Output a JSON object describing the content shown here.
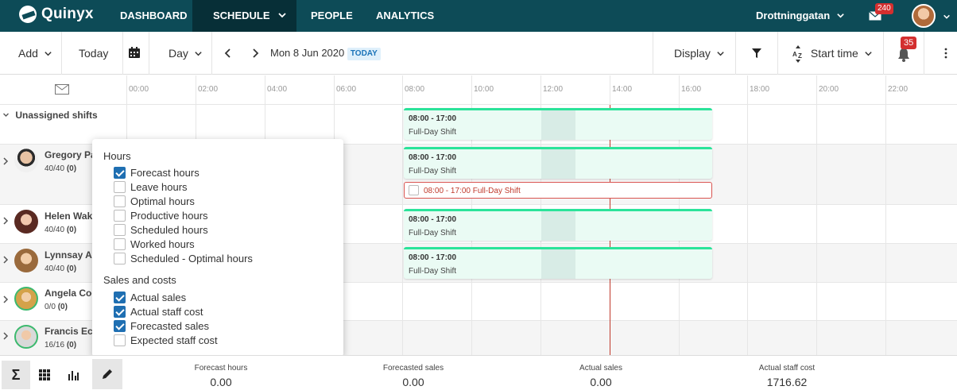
{
  "topnav": {
    "logo_text": "Quinyx",
    "items": [
      {
        "label": "DASHBOARD"
      },
      {
        "label": "SCHEDULE"
      },
      {
        "label": "PEOPLE"
      },
      {
        "label": "ANALYTICS"
      }
    ],
    "location": "Drottninggatan",
    "messages_badge": "240",
    "colors": {
      "bar": "#0d4b57",
      "active": "#072f37"
    }
  },
  "toolbar": {
    "add": "Add",
    "today": "Today",
    "view": "Day",
    "date": "Mon 8 Jun 2020",
    "today_badge": "TODAY",
    "display": "Display",
    "sort": "Start time",
    "notifications_badge": "35"
  },
  "timeline": {
    "hours": [
      "00:00",
      "02:00",
      "04:00",
      "06:00",
      "08:00",
      "10:00",
      "12:00",
      "14:00",
      "16:00",
      "18:00",
      "20:00",
      "22:00"
    ]
  },
  "unassigned": {
    "label": "Unassigned shifts"
  },
  "employees": [
    {
      "name": "Gregory Pa",
      "hours": "40/40",
      "extra": "(0)"
    },
    {
      "name": "Helen Wake",
      "hours": "40/40",
      "extra": "(0)"
    },
    {
      "name": "Lynnsay An",
      "hours": "40/40",
      "extra": "(0)"
    },
    {
      "name": "Angela Coo",
      "hours": "0/0",
      "extra": "(0)"
    },
    {
      "name": "Francis Ecc",
      "hours": "16/16",
      "extra": "(0)"
    }
  ],
  "shifts": [
    {
      "time": "08:00 - 17:00",
      "name": "Full-Day Shift"
    },
    {
      "time": "08:00 - 17:00",
      "name": "Full-Day Shift"
    },
    {
      "time": "08:00 - 17:00",
      "name": "Full-Day Shift"
    },
    {
      "time": "08:00 - 17:00",
      "name": "Full-Day Shift"
    }
  ],
  "unpublished_shift": {
    "time": "08:00 - 17:00",
    "name": "Full-Day Shift"
  },
  "popup": {
    "hours_heading": "Hours",
    "hours_options": [
      {
        "label": "Forecast hours",
        "checked": true
      },
      {
        "label": "Leave hours",
        "checked": false
      },
      {
        "label": "Optimal hours",
        "checked": false
      },
      {
        "label": "Productive hours",
        "checked": false
      },
      {
        "label": "Scheduled hours",
        "checked": false
      },
      {
        "label": "Worked hours",
        "checked": false
      },
      {
        "label": "Scheduled - Optimal hours",
        "checked": false
      }
    ],
    "sales_heading": "Sales and costs",
    "sales_options": [
      {
        "label": "Actual sales",
        "checked": true
      },
      {
        "label": "Actual staff cost",
        "checked": true
      },
      {
        "label": "Forecasted sales",
        "checked": true
      },
      {
        "label": "Expected staff cost",
        "checked": false
      }
    ]
  },
  "footer": {
    "stats": [
      {
        "label": "Forecast hours",
        "value": "0.00"
      },
      {
        "label": "Forecasted sales",
        "value": "0.00"
      },
      {
        "label": "Actual sales",
        "value": "0.00"
      },
      {
        "label": "Actual staff cost",
        "value": "1716.62"
      }
    ]
  }
}
